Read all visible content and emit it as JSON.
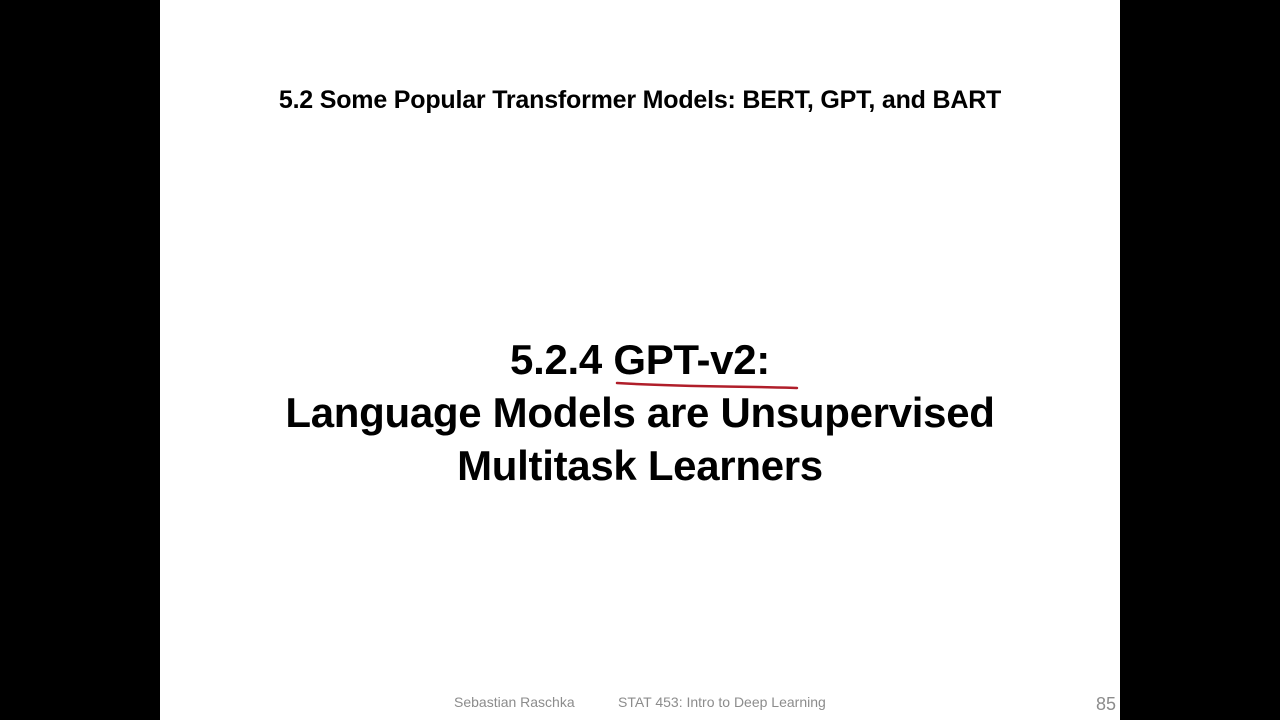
{
  "slide": {
    "section_title": "5.2 Some Popular Transformer Models: BERT, GPT, and BART",
    "main_title": {
      "number": "5.2.4",
      "highlight": "GPT-v2:",
      "line2": "Language Models are Unsupervised",
      "line3": "Multitask Learners"
    },
    "annotation_color": "#b01e2a",
    "footer": {
      "author": "Sebastian Raschka",
      "course": "STAT 453: Intro to Deep Learning",
      "page_number": "85"
    }
  }
}
